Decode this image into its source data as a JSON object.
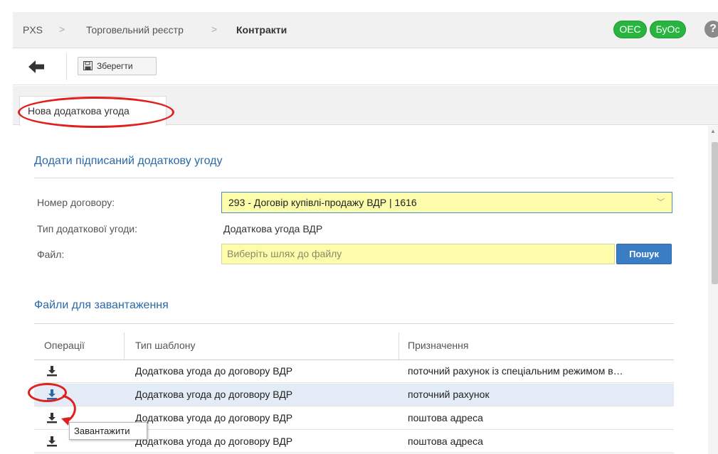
{
  "breadcrumb": {
    "items": [
      "PXS",
      "Торговельний реєстр",
      "Контракти"
    ],
    "separator": ">"
  },
  "badges": [
    "OEC",
    "БуОс"
  ],
  "help_label": "?",
  "toolbar": {
    "save_label": "Зберегти"
  },
  "tab": {
    "label": "Нова додаткова угода"
  },
  "form": {
    "section_title": "Додати підписаний додаткову угоду",
    "contract_label": "Номер договору:",
    "contract_value": "293 - Договір купівлі-продажу ВДР | 1616",
    "type_label": "Тип додаткової угоди:",
    "type_value": "Додаткова угода ВДР",
    "file_label": "Файл:",
    "file_placeholder": "Виберіть шлях до файлу",
    "search_label": "Пошук"
  },
  "files": {
    "section_title": "Файли для завантаження",
    "columns": [
      "Операції",
      "Тип шаблону",
      "Призначення"
    ],
    "rows": [
      {
        "template": "Додаткова угода до договору ВДР",
        "purpose": "поточний рахунок із спеціальним режимом в…"
      },
      {
        "template": "Додаткова угода до договору ВДР",
        "purpose": "поточний рахунок"
      },
      {
        "template": "Додаткова угода до договору ВДР",
        "purpose": "поштова адреса"
      },
      {
        "template": "Додаткова угода до договору ВДР",
        "purpose": "поштова адреса"
      }
    ],
    "selected_row": 1,
    "tooltip": "Завантажити"
  },
  "colors": {
    "accent": "#2a6aa8",
    "badge_green": "#27b53f",
    "highlight_yellow": "#fcfcaa",
    "annotation_red": "#e0201d",
    "selected_row": "#e3ecf6"
  },
  "icons": [
    "back-arrow-icon",
    "save-icon",
    "download-icon",
    "help-icon",
    "chevron-down-icon"
  ]
}
